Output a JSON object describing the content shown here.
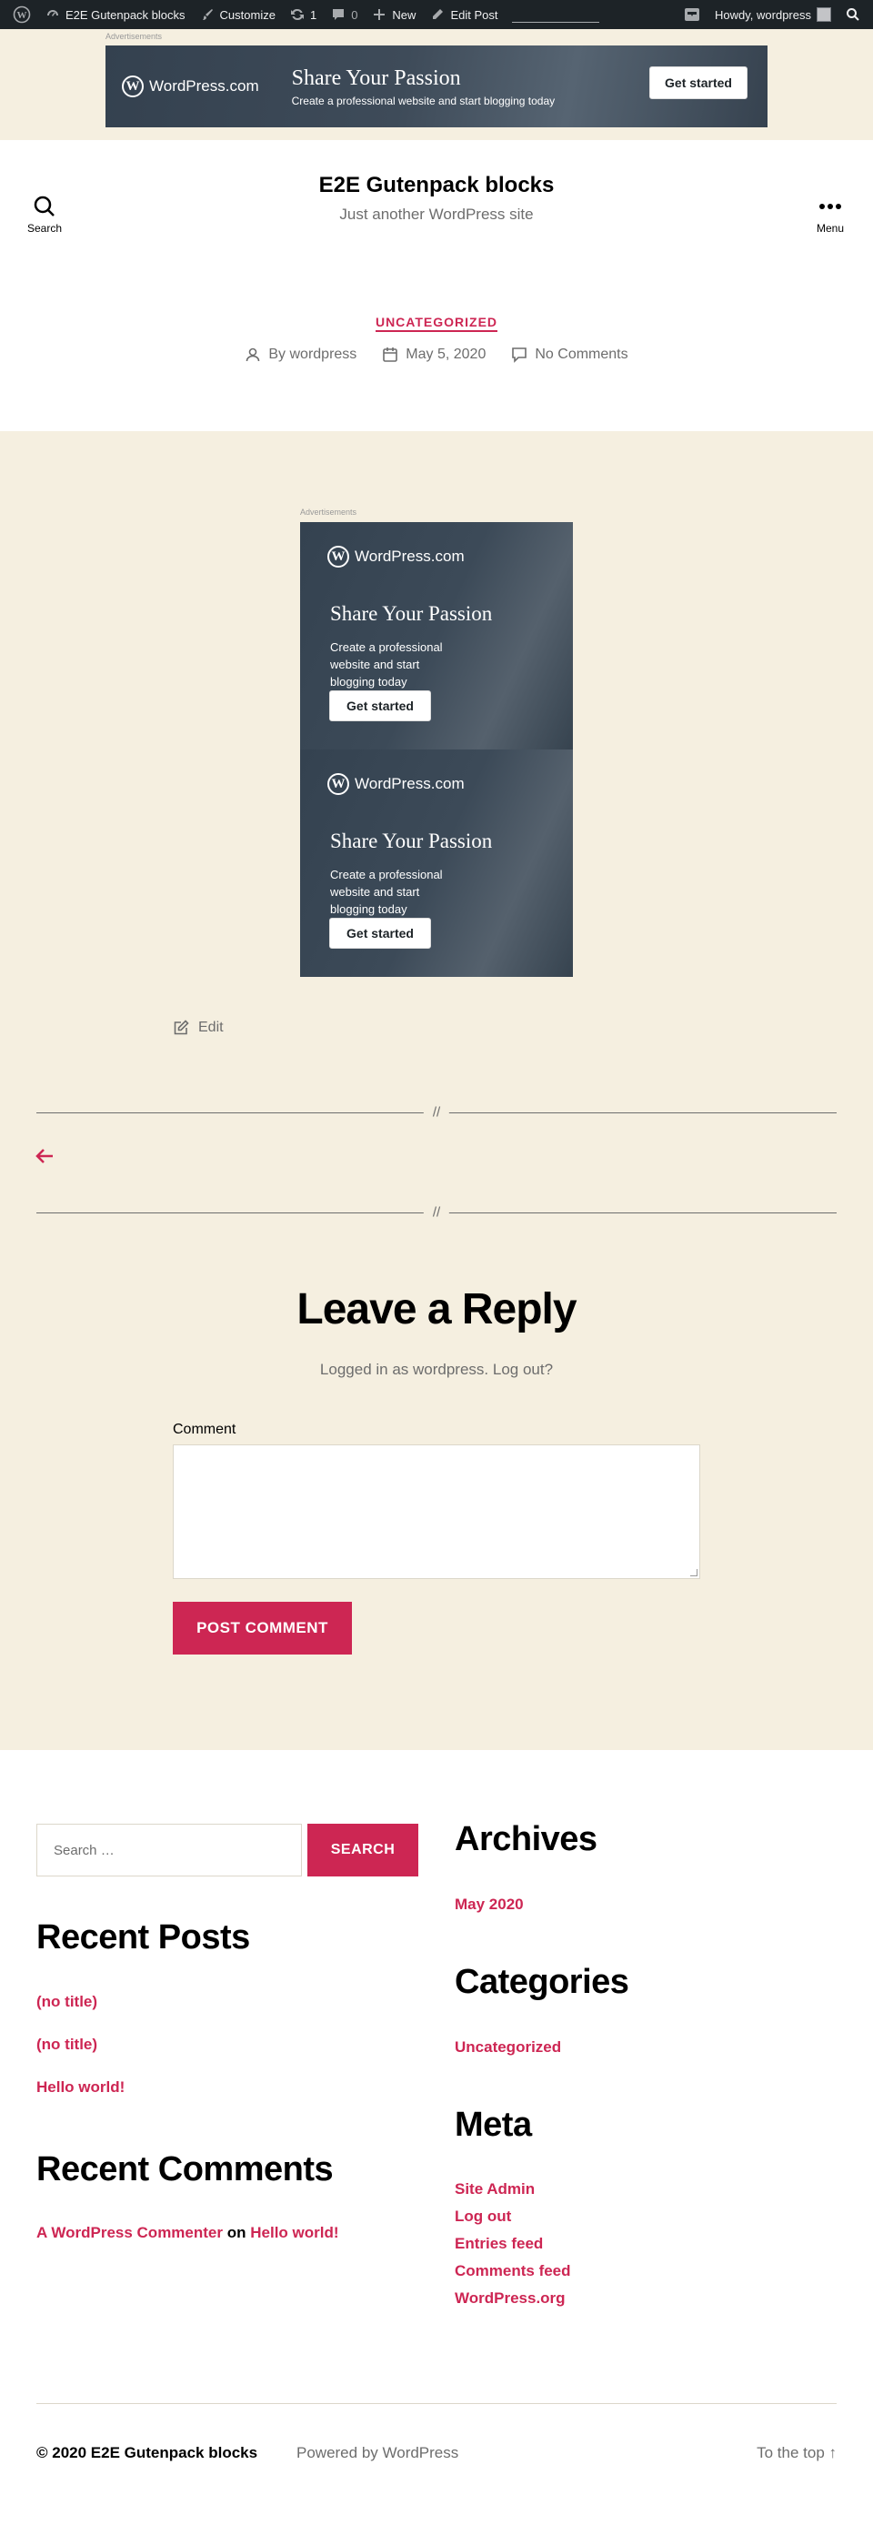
{
  "adminbar": {
    "site_name": "E2E Gutenpack blocks",
    "customize": "Customize",
    "updates": "1",
    "comments": "0",
    "new": "New",
    "edit_post": "Edit Post",
    "howdy": "Howdy, wordpress"
  },
  "ads": {
    "label": "Advertisements",
    "brand": "WordPress.com",
    "headline": "Share Your Passion",
    "banner_sub": "Create a professional website and start blogging today",
    "tall_sub": "Create a professional website and start blogging today",
    "cta": "Get started"
  },
  "header": {
    "title": "E2E Gutenpack blocks",
    "description": "Just another WordPress site",
    "search_label": "Search",
    "menu_label": "Menu"
  },
  "post": {
    "category": "UNCATEGORIZED",
    "author": "By wordpress",
    "date": "May 5, 2020",
    "comments": "No Comments",
    "edit": "Edit",
    "separator_mark": "//"
  },
  "reply": {
    "title": "Leave a Reply",
    "logged_in_prefix": "Logged in as wordpress.",
    "logout": "Log out?",
    "comment_label": "Comment",
    "submit": "POST COMMENT"
  },
  "widgets": {
    "search_placeholder": "Search …",
    "search_button": "SEARCH",
    "recent_posts_title": "Recent Posts",
    "recent_posts": [
      "(no title)",
      "(no title)",
      "Hello world!"
    ],
    "recent_comments_title": "Recent Comments",
    "recent_comment": {
      "author": "A WordPress Commenter",
      "on": "on",
      "post": "Hello world!"
    },
    "archives_title": "Archives",
    "archives": [
      "May 2020"
    ],
    "categories_title": "Categories",
    "categories": [
      "Uncategorized"
    ],
    "meta_title": "Meta",
    "meta": [
      "Site Admin",
      "Log out",
      "Entries feed",
      "Comments feed",
      "WordPress.org"
    ]
  },
  "footer": {
    "copyright": "© 2020 E2E Gutenpack blocks",
    "powered": "Powered by WordPress",
    "to_top": "To the top ↑"
  },
  "colors": {
    "accent": "#cd2653",
    "beige": "#f5efe0",
    "admin_bar": "#1d2327"
  }
}
